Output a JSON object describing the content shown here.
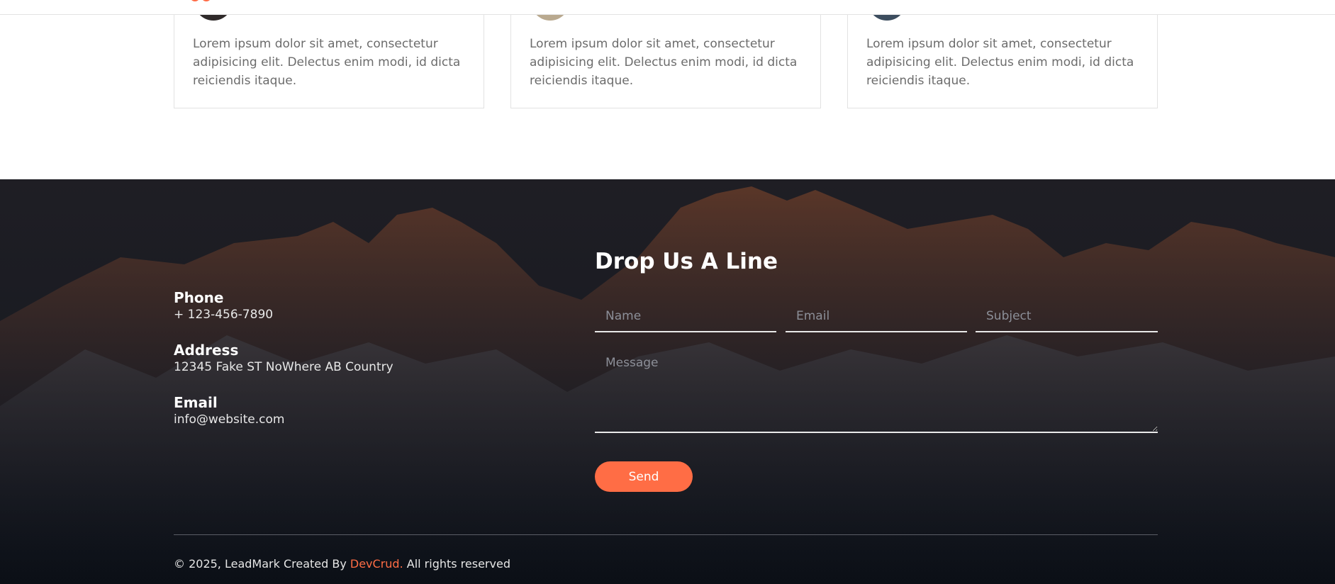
{
  "testimonials": [
    {
      "quote": "Lorem ipsum dolor sit amet, consectetur adipisicing elit. Delectus enim modi, id dicta reiciendis itaque."
    },
    {
      "quote": "Lorem ipsum dolor sit amet, consectetur adipisicing elit. Delectus enim modi, id dicta reiciendis itaque."
    },
    {
      "quote": "Lorem ipsum dolor sit amet, consectetur adipisicing elit. Delectus enim modi, id dicta reiciendis itaque."
    }
  ],
  "contact": {
    "phone_label": "Phone",
    "phone_value": "+ 123-456-7890",
    "address_label": "Address",
    "address_value": "12345 Fake ST NoWhere AB Country",
    "email_label": "Email",
    "email_value": "info@website.com"
  },
  "form": {
    "heading": "Drop Us A Line",
    "name_placeholder": "Name",
    "email_placeholder": "Email",
    "subject_placeholder": "Subject",
    "message_placeholder": "Message",
    "send_label": "Send"
  },
  "footer": {
    "copyright_prefix": "© 2025, LeadMark Created By ",
    "creator_link": "DevCrud.",
    "copyright_suffix": " All rights reserved"
  },
  "colors": {
    "accent": "#ff6d45",
    "footer_bg": "#15171e"
  }
}
